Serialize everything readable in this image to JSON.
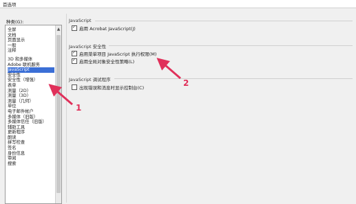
{
  "window": {
    "title": "首选项"
  },
  "categories": {
    "label": "种类(G):",
    "items": [
      "全屏",
      "文档",
      "页面显示",
      "一般",
      "注释",
      "3D 和多媒体",
      "Adobe 联机服务",
      "JavaScript",
      "安全性",
      "安全性（增强）",
      "表单",
      "测量（2D）",
      "测量（3D）",
      "测量（几何）",
      "单位",
      "电子邮件帐户",
      "多媒体（旧版）",
      "多媒体信任（旧版）",
      "辅助工具",
      "更新程序",
      "朗读",
      "拼写检查",
      "签名",
      "身份信息",
      "审阅",
      "搜索"
    ],
    "selected": "JavaScript"
  },
  "javascript": {
    "title": "JavaScript",
    "enable_label": "启用 Acrobat JavaScript(J)",
    "enable_checked": true
  },
  "security": {
    "title": "JavaScript 安全性",
    "menu_priv_label": "启用菜单项目 JavaScript 执行权限(M)",
    "menu_priv_checked": true,
    "global_policy_label": "启用全局对象安全性策略(L)",
    "global_policy_checked": true
  },
  "debugger": {
    "title": "JavaScript 调试程序",
    "show_console_label": "出现错误和消息时显示控制台(C)",
    "show_console_checked": false
  },
  "annotations": {
    "arrow1_label": "1",
    "arrow2_label": "2",
    "color": "#e0305a"
  }
}
